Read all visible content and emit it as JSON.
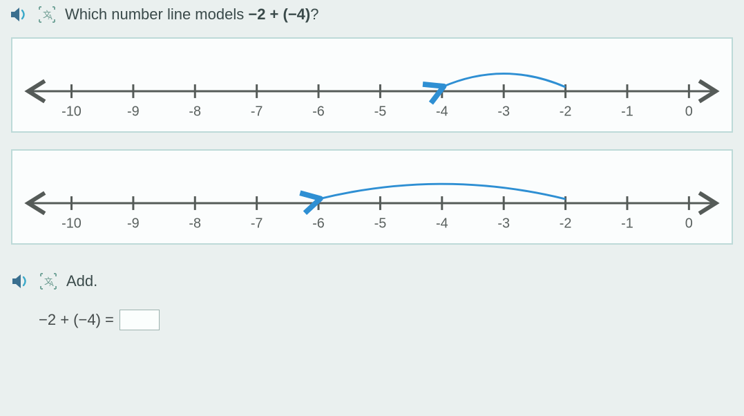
{
  "question": {
    "intro": "Which number line models ",
    "expression": "−2 + (−4)",
    "suffix": "?"
  },
  "labels": [
    "-10",
    "-9",
    "-8",
    "-7",
    "-6",
    "-5",
    "-4",
    "-3",
    "-2",
    "-1",
    "0"
  ],
  "choiceA": {
    "arrow_from": -2,
    "arrow_to": -4
  },
  "choiceB": {
    "arrow_from": -2,
    "arrow_to": -6
  },
  "add_prompt": "Add.",
  "equation_lhs": "−2 + (−4) =",
  "answer_value": "",
  "chart_data": [
    {
      "type": "line",
      "title": "Number line option A",
      "x": [
        -10,
        -9,
        -8,
        -7,
        -6,
        -5,
        -4,
        -3,
        -2,
        -1,
        0
      ],
      "xlabel": "",
      "ylabel": "",
      "arrow": {
        "from": -2,
        "to": -4
      }
    },
    {
      "type": "line",
      "title": "Number line option B",
      "x": [
        -10,
        -9,
        -8,
        -7,
        -6,
        -5,
        -4,
        -3,
        -2,
        -1,
        0
      ],
      "xlabel": "",
      "ylabel": "",
      "arrow": {
        "from": -2,
        "to": -6
      }
    }
  ]
}
